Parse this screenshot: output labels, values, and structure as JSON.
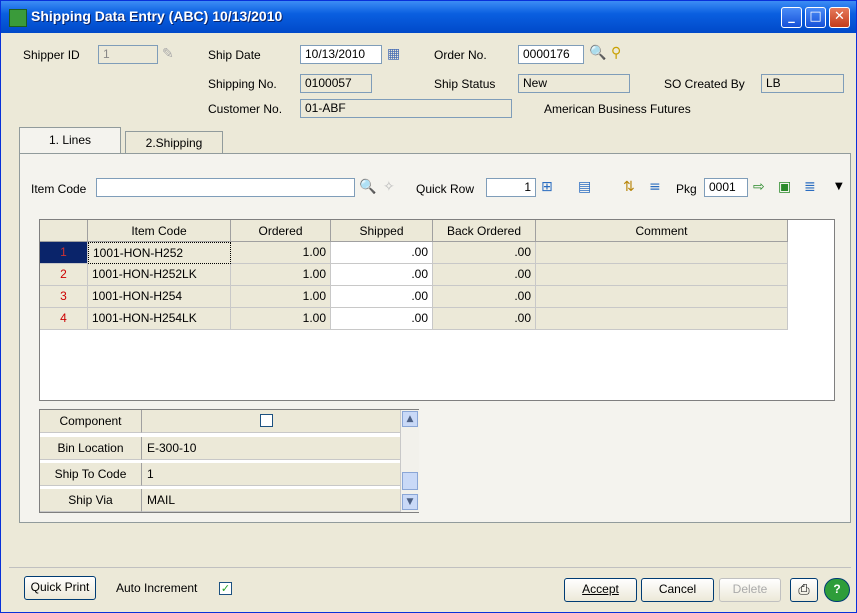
{
  "window": {
    "title": "Shipping Data Entry (ABC) 10/13/2010"
  },
  "header": {
    "shipper_id_label": "Shipper ID",
    "shipper_id_value": "1",
    "ship_date_label": "Ship Date",
    "ship_date_value": "10/13/2010",
    "order_no_label": "Order No.",
    "order_no_value": "0000176",
    "shipping_no_label": "Shipping No.",
    "shipping_no_value": "0100057",
    "ship_status_label": "Ship Status",
    "ship_status_value": "New",
    "so_created_by_label": "SO Created By",
    "so_created_by_value": "LB",
    "customer_no_label": "Customer No.",
    "customer_no_value": "01-ABF",
    "customer_name": "American Business Futures"
  },
  "tabs": [
    {
      "label": "1. Lines"
    },
    {
      "label": "2.Shipping"
    }
  ],
  "lines_toolbar": {
    "item_code_label": "Item Code",
    "item_code_value": "",
    "quick_row_label": "Quick Row",
    "quick_row_value": "1",
    "pkg_label": "Pkg",
    "pkg_value": "0001"
  },
  "grid": {
    "columns": [
      "Item Code",
      "Ordered",
      "Shipped",
      "Back Ordered",
      "Comment"
    ],
    "rows": [
      {
        "num": "1",
        "item": "1001-HON-H252",
        "ordered": "1.00",
        "shipped": ".00",
        "back": ".00",
        "comment": ""
      },
      {
        "num": "2",
        "item": "1001-HON-H252LK",
        "ordered": "1.00",
        "shipped": ".00",
        "back": ".00",
        "comment": ""
      },
      {
        "num": "3",
        "item": "1001-HON-H254",
        "ordered": "1.00",
        "shipped": ".00",
        "back": ".00",
        "comment": ""
      },
      {
        "num": "4",
        "item": "1001-HON-H254LK",
        "ordered": "1.00",
        "shipped": ".00",
        "back": ".00",
        "comment": ""
      }
    ]
  },
  "properties": [
    {
      "label": "Component",
      "value": ""
    },
    {
      "label": "Bin Location",
      "value": "E-300-10"
    },
    {
      "label": "Ship To Code",
      "value": "1"
    },
    {
      "label": "Ship Via",
      "value": "MAIL"
    }
  ],
  "footer": {
    "quick_print": "Quick Print",
    "auto_increment": "Auto Increment",
    "accept": "Accept",
    "cancel": "Cancel",
    "delete": "Delete"
  }
}
